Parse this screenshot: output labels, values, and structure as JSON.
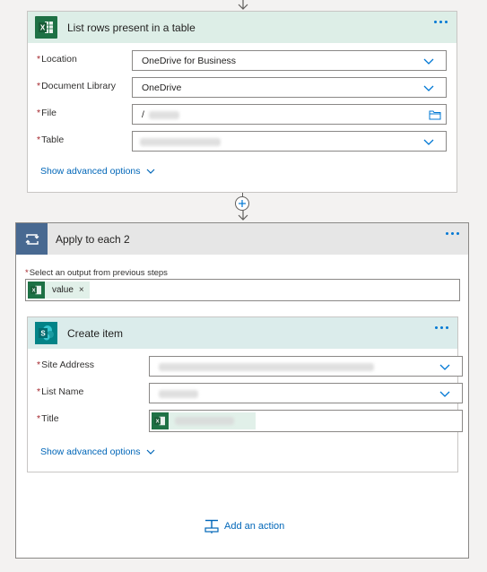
{
  "card1": {
    "title": "List rows present in a table",
    "icon": "excel-icon",
    "accent": "#1e7145",
    "fields": [
      {
        "label": "Location",
        "value": "OneDrive for Business",
        "control": "dropdown"
      },
      {
        "label": "Document Library",
        "value": "OneDrive",
        "control": "dropdown"
      },
      {
        "label": "File",
        "value": "/",
        "control": "file-picker"
      },
      {
        "label": "Table",
        "value": "",
        "control": "dropdown"
      }
    ],
    "advanced_label": "Show advanced options"
  },
  "apply": {
    "title": "Apply to each 2",
    "icon": "loop-icon",
    "accent": "#486991",
    "select_label": "Select an output from previous steps",
    "token": {
      "label": "value",
      "icon": "excel-icon",
      "remove": "×"
    }
  },
  "card2": {
    "title": "Create item",
    "icon": "sharepoint-icon",
    "accent": "#038387",
    "fields": [
      {
        "label": "Site Address",
        "value": "",
        "control": "dropdown"
      },
      {
        "label": "List Name",
        "value": "",
        "control": "dropdown"
      },
      {
        "label": "Title",
        "value": "",
        "control": "token-input"
      }
    ],
    "advanced_label": "Show advanced options"
  },
  "add_action_label": "Add an action",
  "required_mark": "*"
}
